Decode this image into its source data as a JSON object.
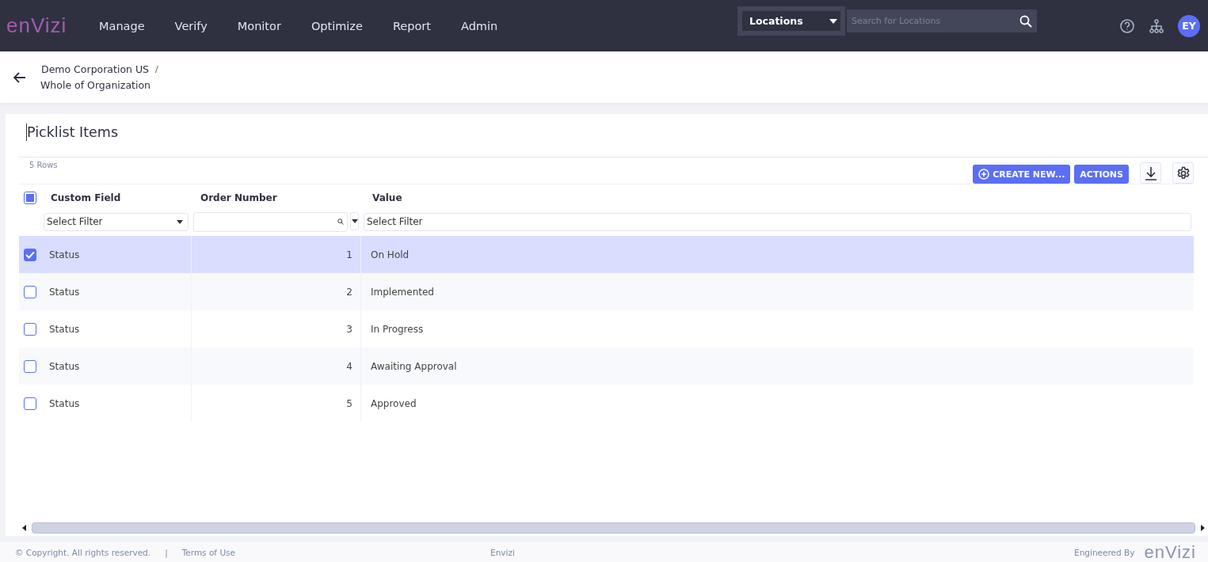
{
  "logo": "enVizi",
  "nav": [
    {
      "label": "Manage"
    },
    {
      "label": "Verify"
    },
    {
      "label": "Monitor"
    },
    {
      "label": "Optimize"
    },
    {
      "label": "Report"
    },
    {
      "label": "Admin"
    }
  ],
  "search": {
    "scope": "Locations",
    "placeholder": "Search for Locations"
  },
  "avatar": "EY",
  "breadcrumb": {
    "parent": "Demo Corporation US",
    "separator": "/",
    "current": "Whole of Organization"
  },
  "title": "Picklist Items",
  "row_count": "5 Rows",
  "buttons": {
    "create": "CREATE NEW...",
    "actions": "ACTIONS"
  },
  "table": {
    "select_all_partial": true,
    "columns": [
      {
        "label": "Custom Field",
        "filter_placeholder": "Select Filter"
      },
      {
        "label": "Order Number"
      },
      {
        "label": "Value",
        "filter_placeholder": "Select Filter"
      }
    ],
    "rows": [
      {
        "custom_field": "Status",
        "order": "1",
        "value": "On Hold",
        "selected": true
      },
      {
        "custom_field": "Status",
        "order": "2",
        "value": "Implemented",
        "selected": false
      },
      {
        "custom_field": "Status",
        "order": "3",
        "value": "In Progress",
        "selected": false
      },
      {
        "custom_field": "Status",
        "order": "4",
        "value": "Awaiting Approval",
        "selected": false
      },
      {
        "custom_field": "Status",
        "order": "5",
        "value": "Approved",
        "selected": false
      }
    ]
  },
  "footer": {
    "copyright": "© Copyright. All rights reserved.",
    "separator": "|",
    "terms": "Terms of Use",
    "center": "Envizi",
    "engineered": "Engineered By",
    "logo": "enVizi"
  }
}
